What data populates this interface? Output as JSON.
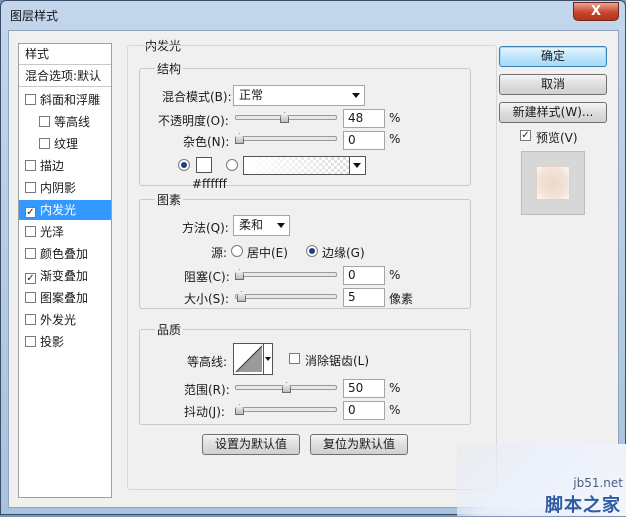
{
  "window": {
    "title": "图层样式",
    "close_label": "X"
  },
  "styles": {
    "header": "样式",
    "blending_item": "混合选项:默认",
    "items": [
      {
        "label": "斜面和浮雕",
        "checked": false,
        "sub": false
      },
      {
        "label": "等高线",
        "checked": false,
        "sub": true
      },
      {
        "label": "纹理",
        "checked": false,
        "sub": true
      },
      {
        "label": "描边",
        "checked": false,
        "sub": false
      },
      {
        "label": "内阴影",
        "checked": false,
        "sub": false
      },
      {
        "label": "内发光",
        "checked": true,
        "sub": false,
        "selected": true
      },
      {
        "label": "光泽",
        "checked": false,
        "sub": false
      },
      {
        "label": "颜色叠加",
        "checked": false,
        "sub": false
      },
      {
        "label": "渐变叠加",
        "checked": true,
        "sub": false
      },
      {
        "label": "图案叠加",
        "checked": false,
        "sub": false
      },
      {
        "label": "外发光",
        "checked": false,
        "sub": false
      },
      {
        "label": "投影",
        "checked": false,
        "sub": false
      }
    ]
  },
  "panel": {
    "title": "内发光",
    "structure": {
      "title": "结构",
      "blend_mode_label": "混合模式(B):",
      "blend_mode_value": "正常",
      "opacity_label": "不透明度(O):",
      "opacity_value": "48",
      "opacity_unit": "%",
      "noise_label": "杂色(N):",
      "noise_value": "0",
      "noise_unit": "%",
      "color_hex": "#ffffff",
      "color_mode": "solid"
    },
    "elements": {
      "title": "图素",
      "technique_label": "方法(Q):",
      "technique_value": "柔和",
      "source_label": "源:",
      "source_center_label": "居中(E)",
      "source_edge_label": "边缘(G)",
      "source_value": "edge",
      "choke_label": "阻塞(C):",
      "choke_value": "0",
      "choke_unit": "%",
      "size_label": "大小(S):",
      "size_value": "5",
      "size_unit": "像素"
    },
    "quality": {
      "title": "品质",
      "contour_label": "等高线:",
      "antialias_label": "消除锯齿(L)",
      "antialias_checked": false,
      "range_label": "范围(R):",
      "range_value": "50",
      "range_unit": "%",
      "jitter_label": "抖动(J):",
      "jitter_value": "0",
      "jitter_unit": "%"
    },
    "make_default_label": "设置为默认值",
    "reset_default_label": "复位为默认值"
  },
  "buttons": {
    "ok": "确定",
    "cancel": "取消",
    "new_style": "新建样式(W)...",
    "preview_label": "预览(V)",
    "preview_checked": true
  },
  "watermark": {
    "url": "jb51.net",
    "name": "脚本之家"
  }
}
